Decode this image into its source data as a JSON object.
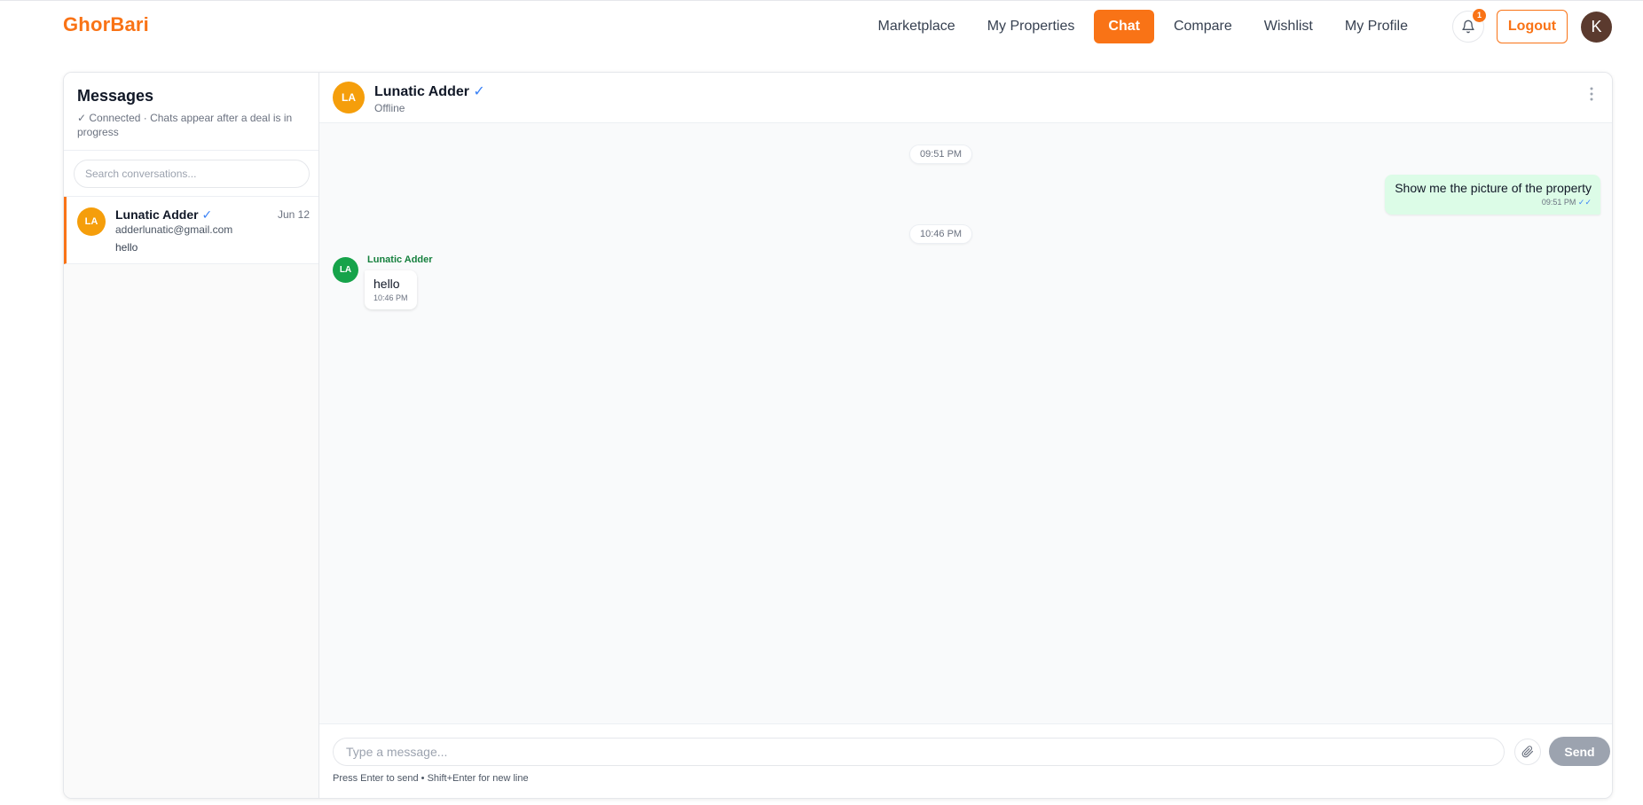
{
  "app": {
    "brand": "GhorBari"
  },
  "nav": {
    "links": [
      "Marketplace",
      "My Properties",
      "Chat",
      "Compare",
      "Wishlist",
      "My Profile"
    ],
    "notification_count": "1",
    "logout_label": "Logout",
    "user_initial": "K"
  },
  "sidebar": {
    "title": "Messages",
    "subtitle": "✓ Connected · Chats appear after a deal is in progress",
    "search_placeholder": "Search conversations...",
    "conversations": [
      {
        "initials": "LA",
        "name": "Lunatic Adder",
        "verified": "✓",
        "email": "adderlunatic@gmail.com",
        "last_message": "hello",
        "date": "Jun 12"
      }
    ]
  },
  "chat": {
    "initials": "LA",
    "name": "Lunatic Adder",
    "verified": "✓",
    "status": "Offline",
    "messages": [
      {
        "divider": "09:51 PM"
      },
      {
        "direction": "out",
        "text": "Show me the picture of the property",
        "time": "09:51 PM",
        "ticks": "✓✓"
      },
      {
        "divider": "10:46 PM"
      },
      {
        "direction": "in",
        "sender": "Lunatic Adder",
        "initials": "LA",
        "text": "hello",
        "time": "10:46 PM"
      }
    ],
    "composer": {
      "placeholder": "Type a message...",
      "send_label": "Send",
      "hint": "Press Enter to send • Shift+Enter for new line"
    }
  },
  "colors": {
    "accent": "#f97316",
    "outgoing_bubble": "#dcfce7",
    "incoming_sender": "#15803d"
  }
}
